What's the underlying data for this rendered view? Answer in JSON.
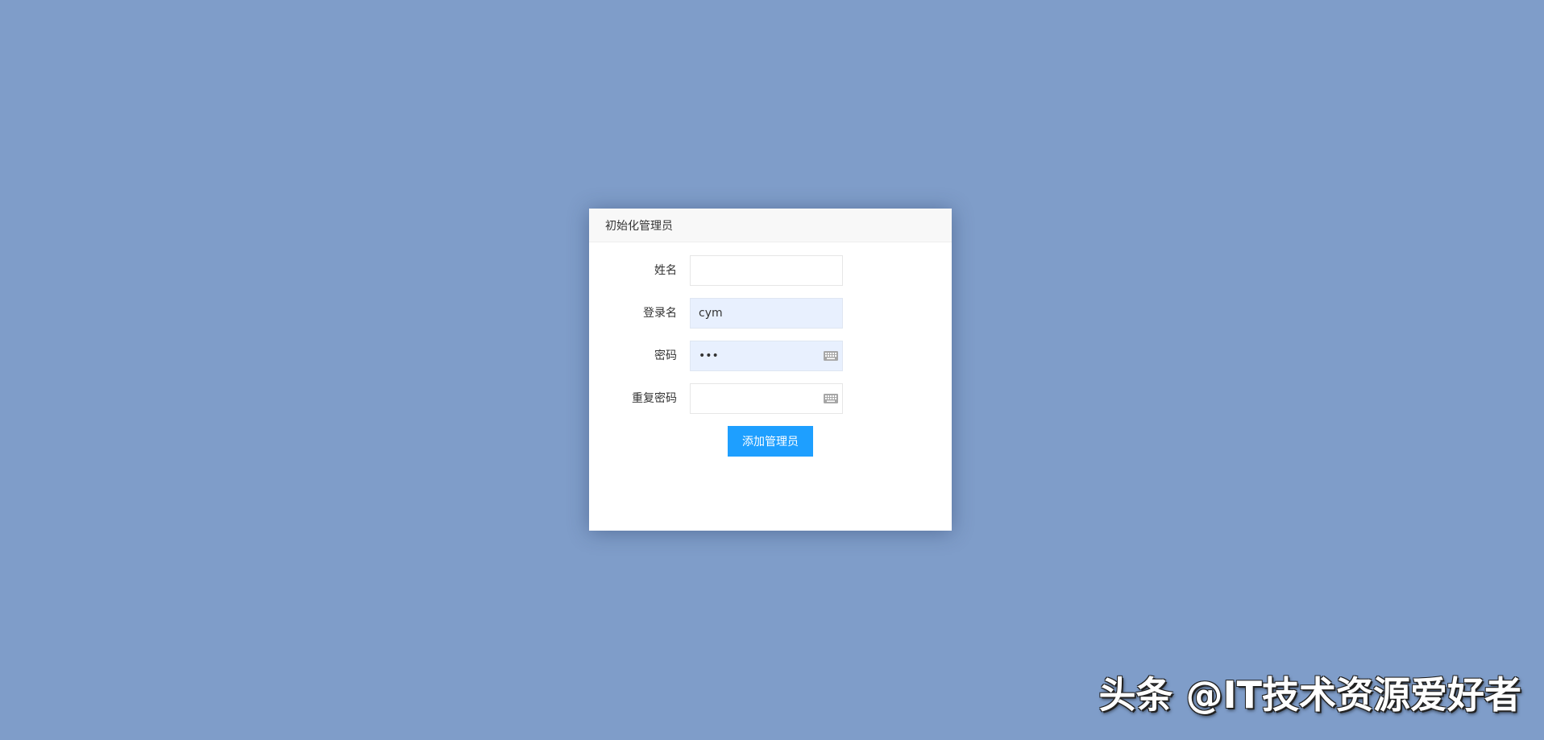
{
  "dialog": {
    "title": "初始化管理员"
  },
  "form": {
    "name": {
      "label": "姓名",
      "value": ""
    },
    "login": {
      "label": "登录名",
      "value": "cym"
    },
    "password": {
      "label": "密码",
      "value": "•••"
    },
    "confirm": {
      "label": "重复密码",
      "value": ""
    },
    "submit_label": "添加管理员"
  },
  "watermark": {
    "text": "头条 @IT技术资源爱好者"
  },
  "icons": {
    "password_keyboard": "keyboard-icon",
    "confirm_keyboard": "keyboard-icon"
  },
  "colors": {
    "background": "#7f9dc9",
    "accent": "#1e9fff",
    "autofill": "#e8f0fe"
  }
}
